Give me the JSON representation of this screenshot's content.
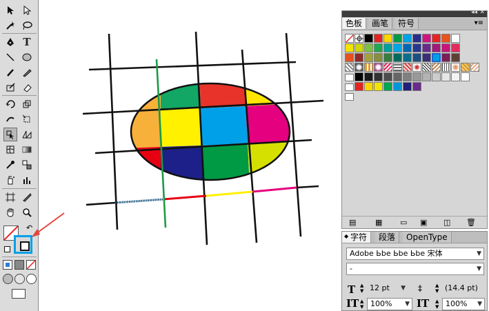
{
  "swatch_panel": {
    "tabs": [
      "色板",
      "画笔",
      "符号"
    ],
    "active_tab": "色板",
    "swatch_rows": [
      [
        "#ffffff",
        "#ffffff",
        "#000000",
        "#e32322",
        "#ffd500",
        "#009a44",
        "#00a4e4",
        "#2a2d8c",
        "#d3137f",
        "#e52325",
        "#e8531d",
        "#ffffff"
      ],
      [
        "#f5e400",
        "#cfd90a",
        "#7cc142",
        "#1fa84f",
        "#00a19a",
        "#00a6e3",
        "#0067b1",
        "#2a3790",
        "#6b2a8d",
        "#a21a7a",
        "#c8157a",
        "#e22c5f"
      ],
      [
        "#e6511f",
        "#8f2a2b",
        "#a3a13e",
        "#878f3f",
        "#397c3f",
        "#006b5d",
        "#0a6e8c",
        "#1d4f82",
        "#3a2f76",
        "#5d2466",
        "#7b1f56",
        "#5d4037"
      ],
      [
        "#c0c0c0",
        "#efe3c5",
        "#e3c99a",
        "#c8a06c",
        "#ad7d4d",
        "#8f5d36",
        "#e0c3a2",
        "#c29b6a",
        "#9c6e3f",
        "#7d5226",
        "#5e3b1c",
        "#3b2513"
      ]
    ],
    "gray_row": [
      "#000000",
      "#1a1a1a",
      "#333333",
      "#4d4d4d",
      "#666666",
      "#808080",
      "#999999",
      "#b3b3b3",
      "#cccccc",
      "#e6e6e6",
      "#f2f2f2",
      "#ffffff"
    ],
    "color_group": [
      "#e32322",
      "#ffd500",
      "#f1e400",
      "#00a651",
      "#0097d6",
      "#231f78",
      "#6c2a8c"
    ]
  },
  "character_panel": {
    "tabs": [
      "字符",
      "段落",
      "OpenType"
    ],
    "font_family": "Adobe Ьbe Ьbe Ьbe 宋体",
    "font_style": "-",
    "font_size": "12 pt",
    "leading": "(14.4 pt)",
    "vertical_scale": "100%",
    "horizontal_scale": "100%"
  },
  "colors": {
    "accent_blue": "#00a0e9",
    "pointer_red": "#e8423a"
  }
}
